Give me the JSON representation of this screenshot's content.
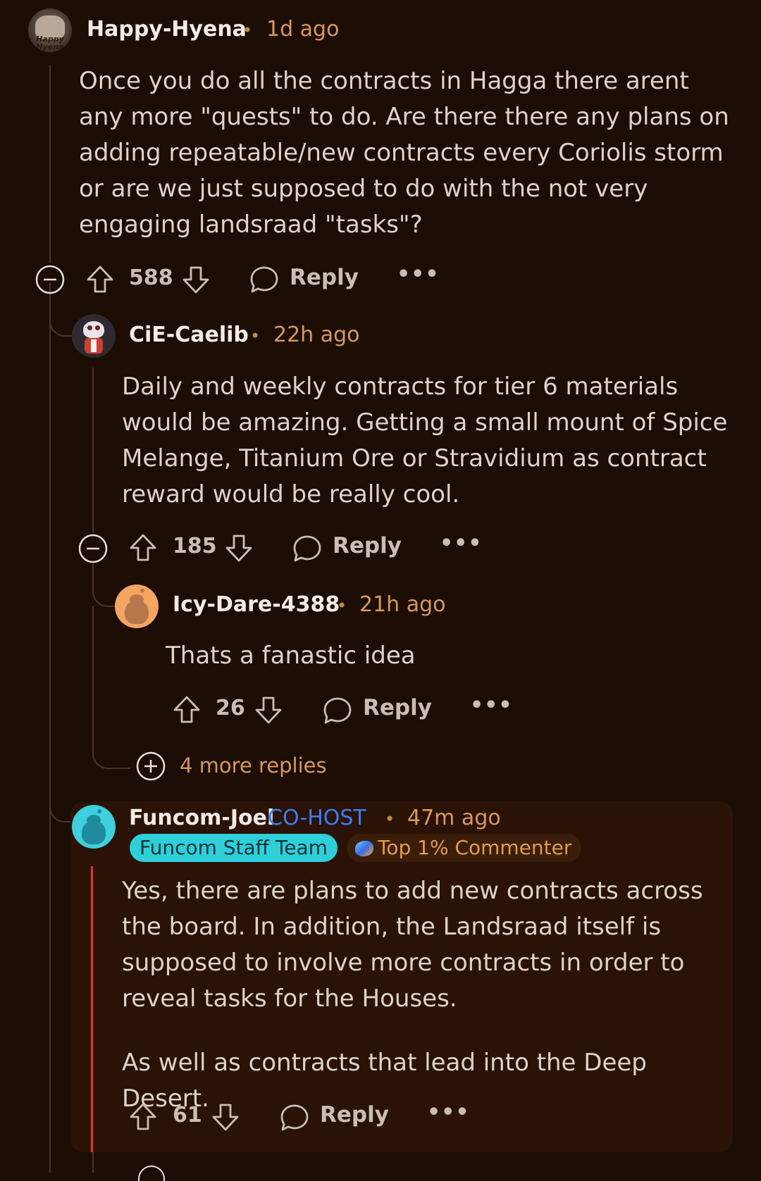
{
  "comments": [
    {
      "author": "Happy-Hyena",
      "time": "1d ago",
      "body": "Once you do all the contracts in Hagga there arent any more \"quests\" to do. Are there there any plans on adding repeatable/new contracts every Coriolis storm or are we just supposed to do with the not very engaging landsraad \"tasks\"?",
      "votes": "588",
      "reply_label": "Reply",
      "avatar_text": "Happy Hyena"
    },
    {
      "author": "CiE-Caelib",
      "time": "22h ago",
      "body": "Daily and weekly contracts for tier 6 materials would be amazing. Getting a small mount of Spice Melange, Titanium Ore or Stravidium as contract reward would be really cool.",
      "votes": "185",
      "reply_label": "Reply"
    },
    {
      "author": "Icy-Dare-4388",
      "time": "21h ago",
      "body": "Thats a fanastic idea",
      "votes": "26",
      "reply_label": "Reply"
    },
    {
      "author": "Funcom-Joel",
      "role": "CO-HOST",
      "time": "47m ago",
      "badges": [
        "Funcom Staff Team",
        "Top 1% Commenter"
      ],
      "body_p1": "Yes, there are plans to add new contracts across the board. In addition, the Landsraad itself is supposed to involve more contracts in order to reveal tasks for the Houses.",
      "body_p2": "As well as contracts that lead into the Deep Desert.",
      "votes": "61",
      "reply_label": "Reply"
    }
  ],
  "more_replies": "4 more replies",
  "separator": "•",
  "colors": {
    "background": "#1b0d04",
    "timestamp": "#d9975a",
    "staff_badge": "#2ecfd9",
    "cohost": "#3a7ff0",
    "highlight_bar": "#e0391c"
  }
}
